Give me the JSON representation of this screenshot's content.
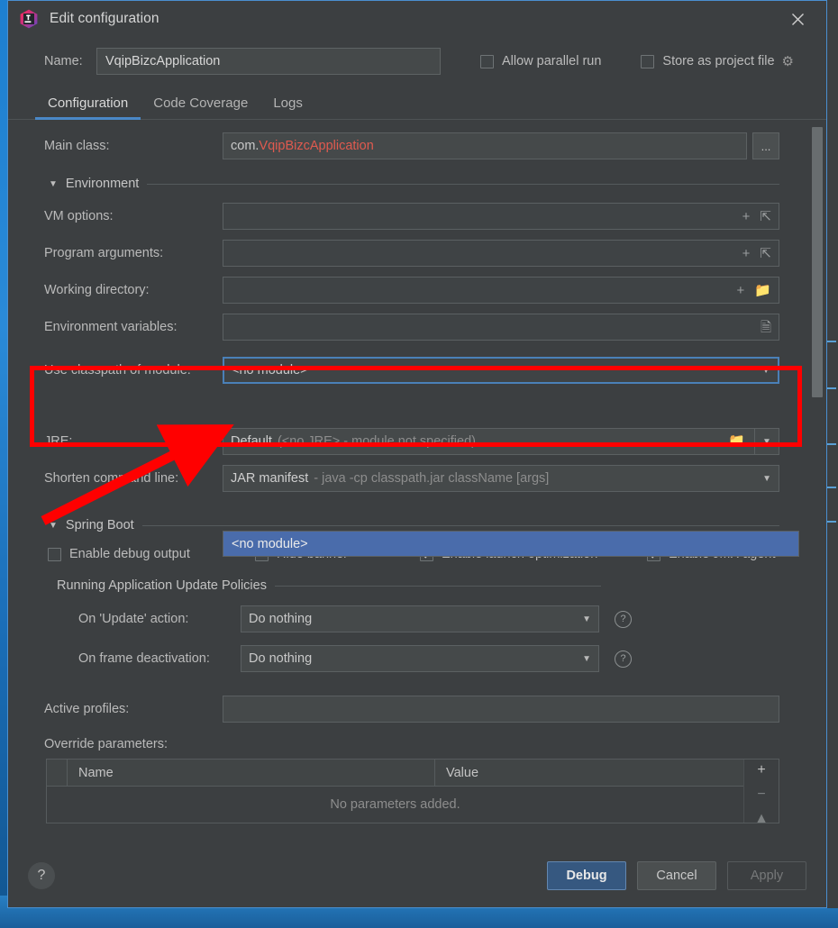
{
  "window": {
    "title": "Edit configuration",
    "app_icon": "intellij-idea-icon",
    "close_icon": "close-icon"
  },
  "name_row": {
    "label": "Name:",
    "value": "VqipBizcApplication",
    "placeholder": "",
    "allow_parallel_run": {
      "label": "Allow parallel run",
      "checked": false
    },
    "store_as_project_file": {
      "label": "Store as project file",
      "checked": false
    },
    "gear_icon": "gear-icon"
  },
  "tabs": [
    {
      "label": "Configuration",
      "active": true
    },
    {
      "label": "Code Coverage",
      "active": false
    },
    {
      "label": "Logs",
      "active": false
    }
  ],
  "form": {
    "main_class": {
      "label": "Main class:",
      "value_prefix": "com.",
      "value_class": "VqipBizcApplication",
      "browse_label": "...",
      "error_color": "#e05a4f"
    },
    "environment_section": {
      "label": "Environment",
      "expanded": true
    },
    "vm_options": {
      "label": "VM options:",
      "value": "",
      "icons": [
        "plus-icon",
        "expand-icon"
      ]
    },
    "program_arguments": {
      "label": "Program arguments:",
      "value": "",
      "icons": [
        "plus-icon",
        "expand-icon"
      ]
    },
    "working_directory": {
      "label": "Working directory:",
      "value": "",
      "icons": [
        "plus-icon",
        "folder-icon"
      ]
    },
    "environment_variables": {
      "label": "Environment variables:",
      "value": "",
      "icons": [
        "list-icon"
      ]
    },
    "use_classpath_of_module": {
      "label": "Use classpath of module:",
      "value": "<no module>",
      "focused": true,
      "dropdown_open": true,
      "options": [
        "<no module>"
      ],
      "selected_option": "<no module>",
      "highlight_color": "#4a6cab"
    },
    "jre": {
      "label": "JRE:",
      "value_main": "Default",
      "value_hint": "(<no JRE> - module not specified)",
      "icons": [
        "folder-icon",
        "chevron-down-icon"
      ]
    },
    "shorten_command_line": {
      "label": "Shorten command line:",
      "value_main": "JAR manifest",
      "value_hint": "- java -cp classpath.jar className [args]"
    }
  },
  "spring_boot": {
    "section_label": "Spring Boot",
    "expanded": true,
    "checkboxes": [
      {
        "label": "Enable debug output",
        "checked": false
      },
      {
        "label": "Hide banner",
        "checked": false
      },
      {
        "label": "Enable launch optimization",
        "checked": true
      },
      {
        "label": "Enable JMX agent",
        "checked": true
      }
    ],
    "update_policies": {
      "section_label": "Running Application Update Policies",
      "on_update_action": {
        "label": "On 'Update' action:",
        "value": "Do nothing",
        "help_icon": "help-icon"
      },
      "on_frame_deactivation": {
        "label": "On frame deactivation:",
        "value": "Do nothing",
        "help_icon": "help-icon"
      }
    },
    "active_profiles": {
      "label": "Active profiles:",
      "value": "",
      "placeholder": ""
    },
    "override_parameters": {
      "label": "Override parameters:",
      "columns": [
        "Name",
        "Value"
      ],
      "rows": [],
      "empty_text": "No parameters added.",
      "tools": [
        "add-icon",
        "remove-icon",
        "move-up-icon"
      ]
    }
  },
  "footer": {
    "help_label": "?",
    "debug_label": "Debug",
    "cancel_label": "Cancel",
    "apply_label": "Apply",
    "apply_enabled": false,
    "primary_color": "#365880"
  },
  "annotations": {
    "highlight_color": "#ff0000",
    "box_target": "use-classpath-of-module-row",
    "arrow_target": "dropdown-option-no-module"
  }
}
